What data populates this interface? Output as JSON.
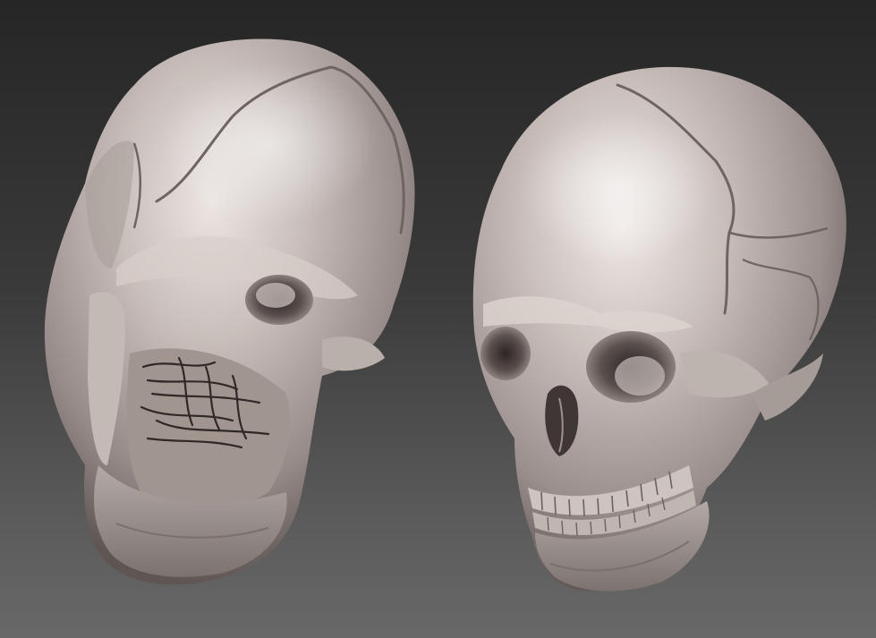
{
  "scene": {
    "background": {
      "top_color": "#262626",
      "bottom_color": "#686868"
    },
    "material": {
      "base_color": "#b8aeaa",
      "highlight_color": "#e6dedb",
      "shadow_color": "#6b6260",
      "crevice_color": "#3a3231"
    },
    "objects": [
      {
        "name": "damaged-skull-sculpt",
        "view": "three-quarter-left-upward"
      },
      {
        "name": "intact-skull-sculpt",
        "view": "three-quarter-left"
      }
    ]
  }
}
